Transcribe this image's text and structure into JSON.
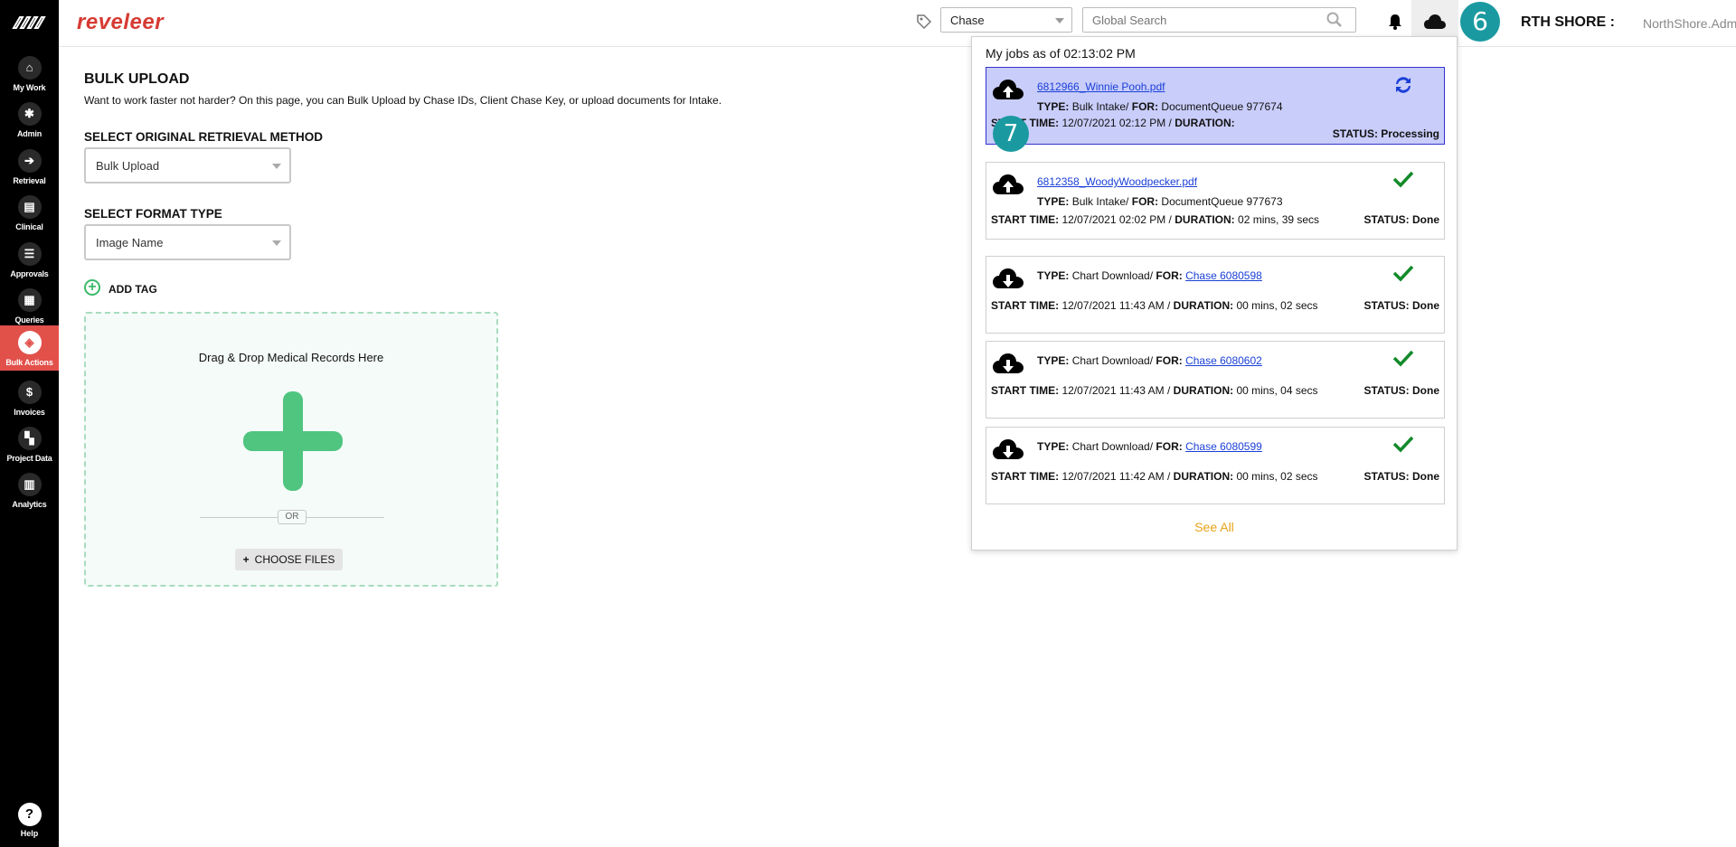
{
  "app": {
    "brand": "reveleer"
  },
  "sidebar": {
    "items": [
      {
        "label": "My Work",
        "icon": "home-icon",
        "glyph": "⌂"
      },
      {
        "label": "Admin",
        "icon": "gear-icon",
        "glyph": "✱"
      },
      {
        "label": "Retrieval",
        "icon": "arrow-right-icon",
        "glyph": "➔"
      },
      {
        "label": "Clinical",
        "icon": "clipboard-icon",
        "glyph": "▤"
      },
      {
        "label": "Approvals",
        "icon": "list-icon",
        "glyph": "☰"
      },
      {
        "label": "Queries",
        "icon": "document-icon",
        "glyph": "▦"
      },
      {
        "label": "Bulk Actions",
        "icon": "layers-icon",
        "glyph": "◈"
      },
      {
        "label": "Invoices",
        "icon": "dollar-icon",
        "glyph": "$"
      },
      {
        "label": "Project Data",
        "icon": "grid-icon",
        "glyph": "▚"
      },
      {
        "label": "Analytics",
        "icon": "chart-icon",
        "glyph": "▥"
      }
    ],
    "active": "Bulk Actions",
    "help": {
      "label": "Help",
      "glyph": "?"
    }
  },
  "header": {
    "search_type": "Chase",
    "global_search_placeholder": "Global Search",
    "org_name": "RTH SHORE :",
    "user_name": "NorthShore.Admin",
    "step_badge": "6"
  },
  "page": {
    "title": "BULK UPLOAD",
    "description": "Want to work faster not harder? On this page, you can Bulk Upload by Chase IDs, Client Chase Key, or upload documents for Intake.",
    "retrieval_label": "SELECT ORIGINAL RETRIEVAL METHOD",
    "retrieval_value": "Bulk Upload",
    "format_label": "SELECT FORMAT TYPE",
    "format_value": "Image Name",
    "add_tag": "ADD TAG",
    "dropzone_text": "Drag & Drop Medical Records Here",
    "or_text": "OR",
    "choose_files": "CHOOSE FILES"
  },
  "jobs_panel": {
    "title": "My jobs as of 02:13:02 PM",
    "see_all": "See All",
    "step_badge": "7",
    "jobs": [
      {
        "file": "6812966_Winnie Pooh.pdf",
        "type_label": "TYPE:",
        "type": "Bulk Intake/",
        "for_label": "FOR:",
        "for": "DocumentQueue 977674",
        "start_label": "START TIME:",
        "start": "12/07/2021 02:12 PM /",
        "duration_label": "DURATION:",
        "duration": "",
        "status": "STATUS: Processing",
        "icon": "cloud-upload-icon",
        "state_icon": "sync-icon"
      },
      {
        "file": "6812358_WoodyWoodpecker.pdf",
        "type_label": "TYPE:",
        "type": "Bulk Intake/",
        "for_label": "FOR:",
        "for": "DocumentQueue 977673",
        "start_label": "START TIME:",
        "start": "12/07/2021 02:02 PM /",
        "duration_label": "DURATION:",
        "duration": "02 mins, 39 secs",
        "status": "STATUS: Done",
        "icon": "cloud-upload-icon",
        "state_icon": "check-icon"
      },
      {
        "type_label": "TYPE:",
        "type": "Chart Download/",
        "for_label": "FOR:",
        "for": "Chase 6080598",
        "start_label": "START TIME:",
        "start": "12/07/2021 11:43 AM /",
        "duration_label": "DURATION:",
        "duration": "00 mins, 02 secs",
        "status": "STATUS: Done",
        "icon": "cloud-download-icon",
        "state_icon": "check-icon"
      },
      {
        "type_label": "TYPE:",
        "type": "Chart Download/",
        "for_label": "FOR:",
        "for": "Chase 6080602",
        "start_label": "START TIME:",
        "start": "12/07/2021 11:43 AM /",
        "duration_label": "DURATION:",
        "duration": "00 mins, 04 secs",
        "status": "STATUS: Done",
        "icon": "cloud-download-icon",
        "state_icon": "check-icon"
      },
      {
        "type_label": "TYPE:",
        "type": "Chart Download/",
        "for_label": "FOR:",
        "for": "Chase 6080599",
        "start_label": "START TIME:",
        "start": "12/07/2021 11:42 AM /",
        "duration_label": "DURATION:",
        "duration": "00 mins, 02 secs",
        "status": "STATUS: Done",
        "icon": "cloud-download-icon",
        "state_icon": "check-icon"
      }
    ]
  },
  "colors": {
    "brand": "#d63a33",
    "active_nav": "#e2504a",
    "processing_bg": "#c9cdfa",
    "done_check": "#138a2a",
    "link": "#1a3fd6",
    "see_all": "#e8a317",
    "badge": "#1a9aa0",
    "dropzone_accent": "#4fc57f"
  }
}
